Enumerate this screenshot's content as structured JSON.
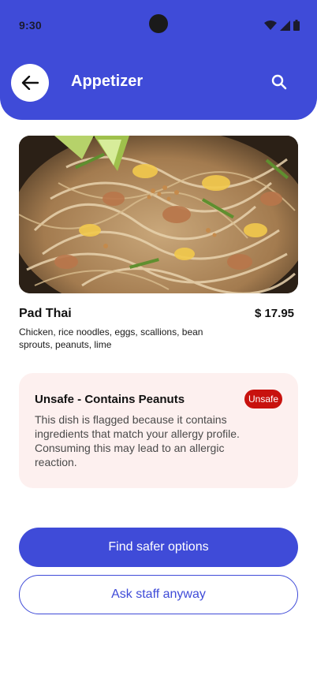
{
  "status_bar": {
    "time": "9:30",
    "icons": [
      "wifi-icon",
      "signal-icon",
      "battery-icon"
    ]
  },
  "header": {
    "title": "Appetizer",
    "back_icon": "arrow-left-icon",
    "search_icon": "search-icon",
    "color": "#3f4bd8"
  },
  "dish": {
    "image_alt": "Pad Thai photo",
    "name": "Pad Thai",
    "price": "$ 17.95",
    "description": "Chicken, rice noodles, eggs, scallions, bean sprouts, peanuts, lime"
  },
  "warning": {
    "title": "Unsafe - Contains Peanuts",
    "badge": "Unsafe",
    "badge_color": "#c8120e",
    "body": "This dish is flagged because it contains ingredients that match your allergy profile. Consuming this may lead to an allergic reaction.",
    "background": "#fdf0ef"
  },
  "actions": {
    "primary_label": "Find safer options",
    "secondary_label": "Ask staff anyway"
  }
}
